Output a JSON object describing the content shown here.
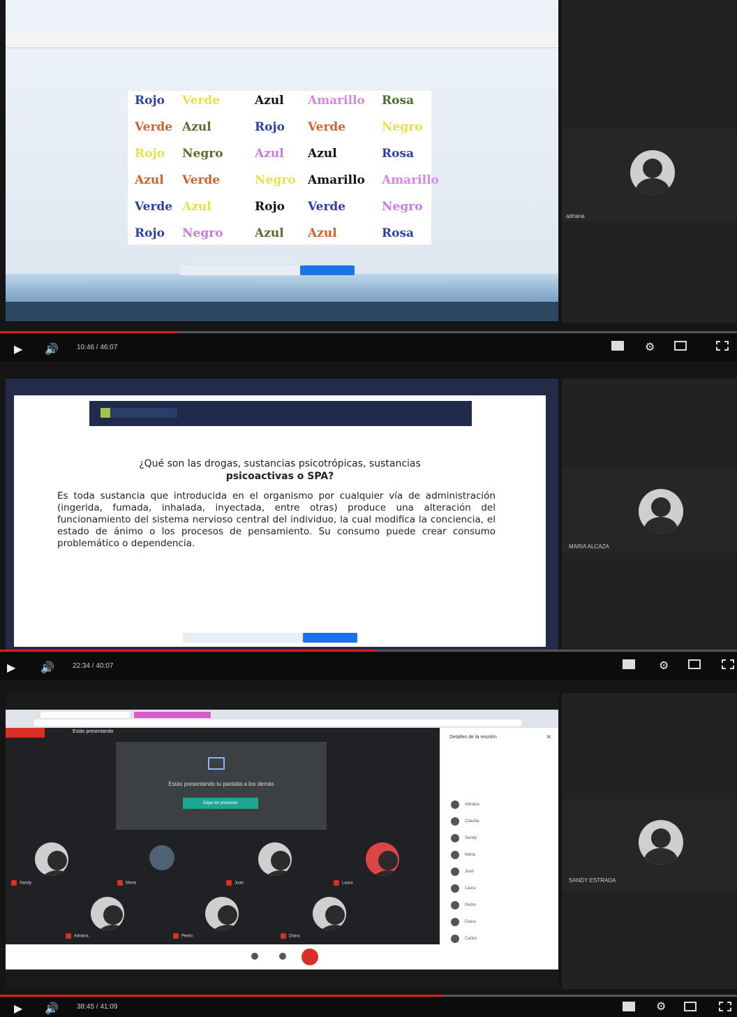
{
  "panels": [
    {
      "time": "10:46 / 46:07",
      "progress": 0.24,
      "participant": "adriana",
      "stroop": {
        "rows": [
          [
            {
              "t": "Rojo",
              "c": "#2b3fa8"
            },
            {
              "t": "Verde",
              "c": "#e6e04a"
            },
            {
              "t": "Azul",
              "c": "#111111"
            },
            {
              "t": "Amarillo",
              "c": "#d985e6"
            },
            {
              "t": "Rosa",
              "c": "#4a6b2a"
            }
          ],
          [
            {
              "t": "Verde",
              "c": "#d2622c"
            },
            {
              "t": "Azul",
              "c": "#5c6b2b"
            },
            {
              "t": "Rojo",
              "c": "#2b3fa8"
            },
            {
              "t": "Verde",
              "c": "#d2622c"
            },
            {
              "t": "Negro",
              "c": "#e6e04a"
            }
          ],
          [
            {
              "t": "Rojo",
              "c": "#e6e04a"
            },
            {
              "t": "Negro",
              "c": "#5c6b2b"
            },
            {
              "t": "Azul",
              "c": "#c77be3"
            },
            {
              "t": "Azul",
              "c": "#111111"
            },
            {
              "t": "Rosa",
              "c": "#2b3fa8"
            }
          ],
          [
            {
              "t": "Azul",
              "c": "#d2622c"
            },
            {
              "t": "Verde",
              "c": "#d2622c"
            },
            {
              "t": "Negro",
              "c": "#e6e04a"
            },
            {
              "t": "Amarillo",
              "c": "#111111"
            },
            {
              "t": "Amarillo",
              "c": "#d985e6"
            }
          ],
          [
            {
              "t": "Verde",
              "c": "#2b3fa8"
            },
            {
              "t": "Azul",
              "c": "#e6e04a"
            },
            {
              "t": "Rojo",
              "c": "#111111"
            },
            {
              "t": "Verde",
              "c": "#2b3fa8"
            },
            {
              "t": "Negro",
              "c": "#c77be3"
            }
          ],
          [
            {
              "t": "Rojo",
              "c": "#2b3fa8"
            },
            {
              "t": "Negro",
              "c": "#c77be3"
            },
            {
              "t": "Azul",
              "c": "#5c6b2b"
            },
            {
              "t": "Azul",
              "c": "#d2622c"
            },
            {
              "t": "Rosa",
              "c": "#2b3fa8"
            }
          ]
        ]
      }
    },
    {
      "time": "22:34 / 40:07",
      "progress": 0.51,
      "participant": "MARIA ALCAZA",
      "question_line1": "¿Qué son las drogas, sustancias psicotrópicas, sustancias",
      "question_line2": "psicoactivas o SPA?",
      "body": "Es toda sustancia que introducida en el organismo por cualquier vía de administración (ingerida, fumada, inhalada, inyectada, entre otras) produce una alteración del funcionamiento del sistema nervioso central del individuo, la cual modifica la conciencia, el estado de ánimo o los procesos de pensamiento. Su consumo puede crear consumo problemático o dependencia."
    },
    {
      "time": "38:45 / 41:09",
      "progress": 0.6,
      "participant": "SANDY ESTRADA",
      "meet": {
        "presenting_label": "Estás presentando",
        "presenting_text": "Estás presentando tu pantalla a los demás",
        "stop_button": "Dejar de presentar",
        "people_title": "Detalles de la reunión",
        "people": [
          "Adriana",
          "Claudia",
          "Sandy",
          "Maria",
          "Juan",
          "Laura",
          "Pedro",
          "Diana",
          "Carlos"
        ],
        "tiles": [
          "Sandy",
          "Maria",
          "Juan",
          "Laura",
          "Adriana",
          "Pedro",
          "Diana"
        ]
      }
    }
  ]
}
